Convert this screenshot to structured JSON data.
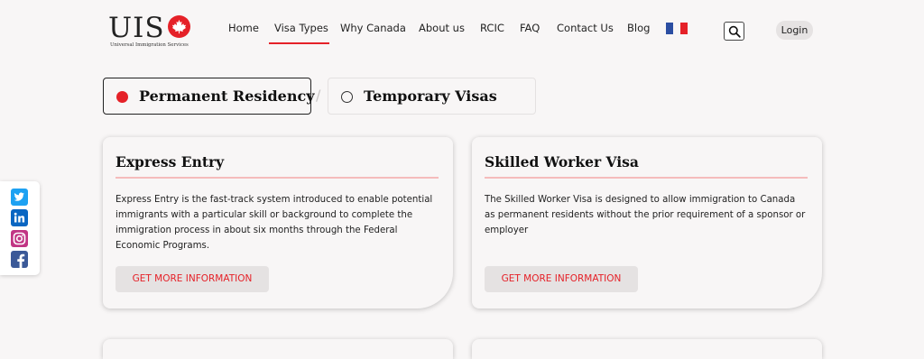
{
  "logo": {
    "text": "UIS",
    "subtitle": "Universal Immigration Services"
  },
  "nav": {
    "items": [
      {
        "label": "Home"
      },
      {
        "label": "Visa Types"
      },
      {
        "label": "Why Canada"
      },
      {
        "label": "About us"
      },
      {
        "label": "RCIC"
      },
      {
        "label": "FAQ"
      },
      {
        "label": "Contact Us"
      },
      {
        "label": "Blog"
      }
    ],
    "active": "Visa Types",
    "language_flag": "flag-france-icon",
    "search_icon": "search-icon",
    "login_label": "Login"
  },
  "tabs": [
    {
      "label": "Permanent Residency",
      "selected": true
    },
    {
      "label": "Temporary Visas",
      "selected": false
    }
  ],
  "tab_separator": "/",
  "social": [
    "twitter-icon",
    "linkedin-icon",
    "instagram-icon",
    "facebook-icon"
  ],
  "cards": [
    {
      "title": "Express Entry",
      "description": "Express Entry is the fast-track system introduced to enable potential immigrants with a particular skill or background to complete the immigration process in about six months through the Federal Economic Programs.",
      "button": "GET MORE INFORMATION"
    },
    {
      "title": "Skilled Worker Visa",
      "description": "The Skilled Worker Visa is designed to allow immigration to Canada as permanent residents without the prior requirement of a sponsor or employer",
      "button": "GET MORE INFORMATION"
    }
  ],
  "colors": {
    "accent": "#e52128",
    "background": "#f8f6f6",
    "card_rule": "#f5bcbc",
    "button_bg": "#e5e2e2"
  }
}
